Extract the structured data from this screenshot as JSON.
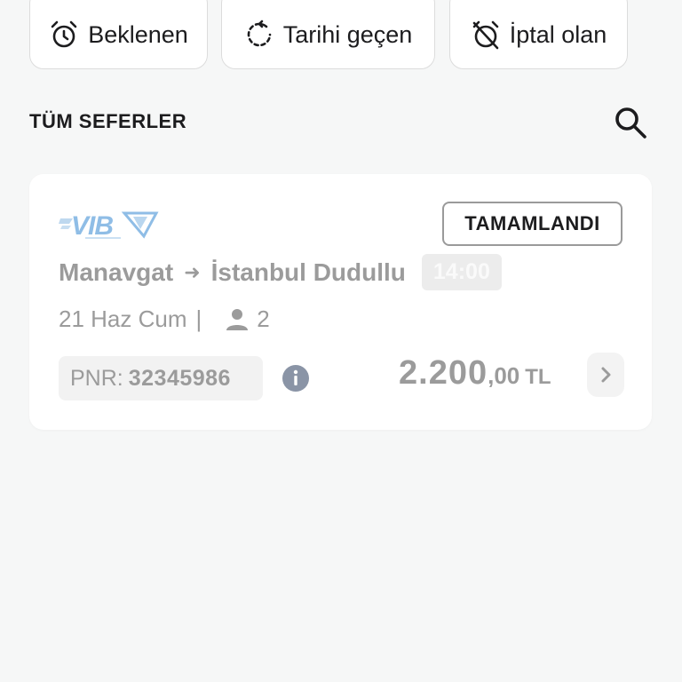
{
  "filters": [
    {
      "label": "Beklenen",
      "icon": "alarm-clock-icon"
    },
    {
      "label": "Tarihi geçen",
      "icon": "refresh-clock-icon"
    },
    {
      "label": "İptal olan",
      "icon": "alarm-off-icon"
    }
  ],
  "section": {
    "title": "TÜM SEFERLER",
    "search_icon": "search-icon"
  },
  "trip": {
    "logo_text": "VIB",
    "status": "TAMAMLANDI",
    "origin": "Manavgat",
    "destination": "İstanbul Dudullu",
    "time": "14:00",
    "date": "21 Haz Cum",
    "separator": "|",
    "passengers": "2",
    "pnr_label": "PNR:",
    "pnr_value": "32345986",
    "price_amount": "2.200",
    "price_decimals": ",00",
    "currency": "TL"
  },
  "colors": {
    "background": "#f6f7f7",
    "card": "#ffffff",
    "muted_text": "#9b9b9b",
    "info_icon": "#8a94a6",
    "logo_blue": "#7fb2e0"
  }
}
